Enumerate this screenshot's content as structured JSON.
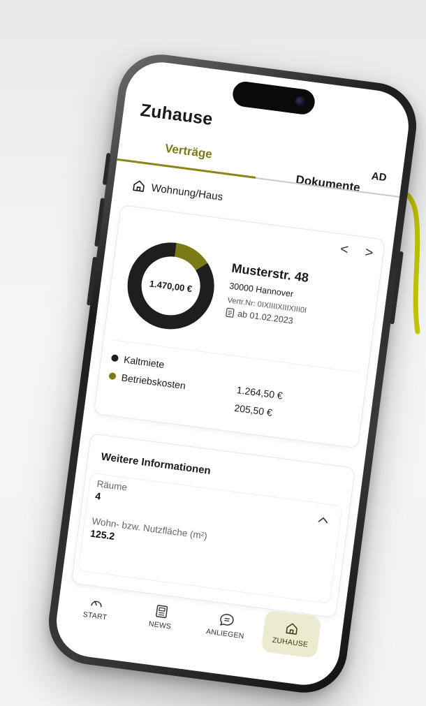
{
  "app": {
    "title": "Zuhause"
  },
  "tabs": {
    "active": "Verträge",
    "other": "Dokumente",
    "user_initials": "AD"
  },
  "section": {
    "label": "Wohnung/Haus"
  },
  "contract": {
    "nav_prev": "<",
    "nav_next": ">",
    "total": "1.470,00 €",
    "street": "Musterstr. 48",
    "city": "30000 Hannover",
    "contract_number": "Vertr.Nr: 0IXIIIIXIIIXIII0I",
    "valid_from": "ab 01.02.2023",
    "breakdown": [
      {
        "label": "Kaltmiete",
        "amount": "1.264,50 €",
        "value": 1264.5,
        "color": "#1e1e1e"
      },
      {
        "label": "Betriebskosten",
        "amount": "205,50 €",
        "value": 205.5,
        "color": "#7c7a14"
      }
    ]
  },
  "info": {
    "title": "Weitere Informationen",
    "rooms_label": "Räume",
    "rooms_value": "4",
    "area_label": "Wohn- bzw. Nutzfläche (m²)",
    "area_value": "125.2"
  },
  "bottom_nav": {
    "start": "START",
    "news": "NEWS",
    "anliegen": "ANLIEGEN",
    "zuhause": "ZUHAUSE",
    "active": "ZUHAUSE"
  },
  "colors": {
    "accent": "#7c7a14",
    "accent_bg": "#ecebd0",
    "dark": "#1e1e1e",
    "arrow": "#c6c800"
  }
}
